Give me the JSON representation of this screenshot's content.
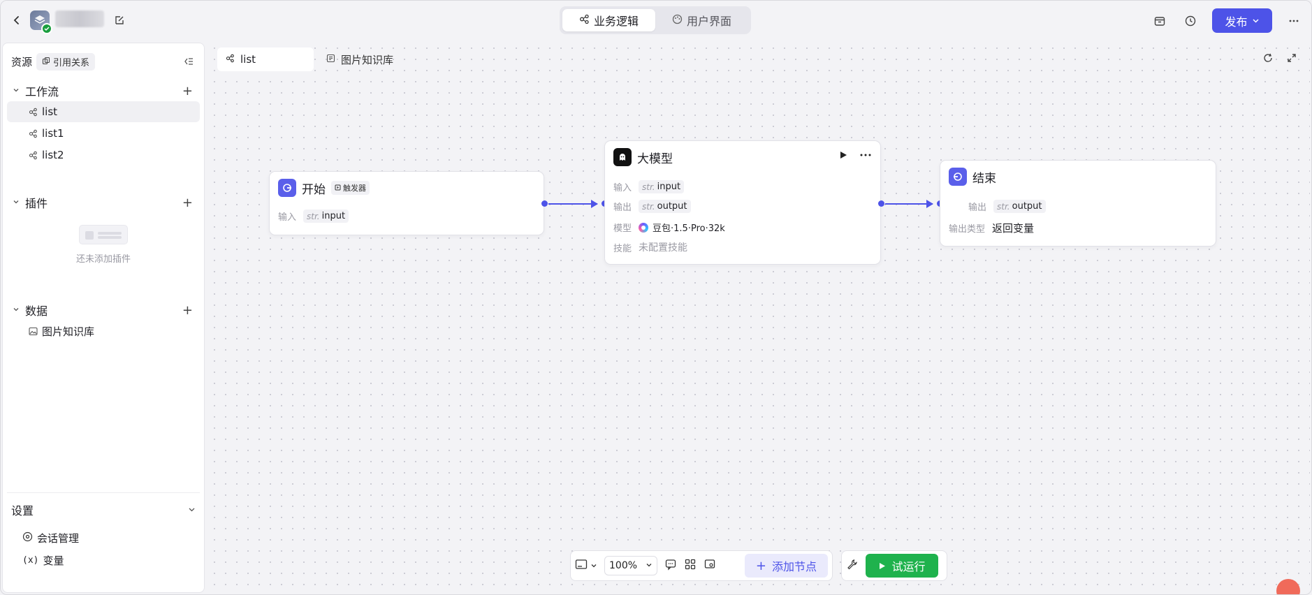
{
  "topbar": {
    "mode_tabs": [
      {
        "label": "业务逻辑",
        "icon": "workflow-icon",
        "active": true
      },
      {
        "label": "用户界面",
        "icon": "palette-icon",
        "active": false
      }
    ],
    "publish_label": "发布"
  },
  "sidebar": {
    "title": "资源",
    "ref_tag": "引用关系",
    "workflow": {
      "label": "工作流",
      "items": [
        {
          "label": "list",
          "active": true
        },
        {
          "label": "list1",
          "active": false
        },
        {
          "label": "list2",
          "active": false
        }
      ]
    },
    "plugins": {
      "label": "插件",
      "empty_text": "还未添加插件"
    },
    "data": {
      "label": "数据",
      "items": [
        {
          "label": "图片知识库"
        }
      ]
    },
    "settings": {
      "label": "设置",
      "items": [
        {
          "label": "会话管理",
          "icon": "chat-manage-icon"
        },
        {
          "label": "变量",
          "icon": "variable-icon"
        }
      ]
    }
  },
  "canvas": {
    "tabs": [
      {
        "label": "list",
        "active": true
      },
      {
        "label": "图片知识库",
        "active": false
      }
    ],
    "nodes": {
      "start": {
        "title": "开始",
        "tag": "触发器",
        "input_key": "输入",
        "input_type": "str.",
        "input_value": "input",
        "icon_color": "#5a5fea"
      },
      "llm": {
        "title": "大模型",
        "input_key": "输入",
        "input_type": "str.",
        "input_value": "input",
        "output_key": "输出",
        "output_type": "str.",
        "output_value": "output",
        "model_key": "模型",
        "model_value": "豆包·1.5·Pro·32k",
        "skill_key": "技能",
        "skill_value": "未配置技能"
      },
      "end": {
        "title": "结束",
        "output_key": "输出",
        "output_type": "str.",
        "output_value": "output",
        "output_type_key": "输出类型",
        "output_type_value": "返回变量",
        "icon_color": "#5a5fea"
      }
    }
  },
  "toolbar": {
    "zoom": "100%",
    "add_node_label": "添加节点",
    "run_label": "试运行"
  },
  "colors": {
    "accent": "#4d53e8",
    "run_green": "#1fb24d"
  }
}
